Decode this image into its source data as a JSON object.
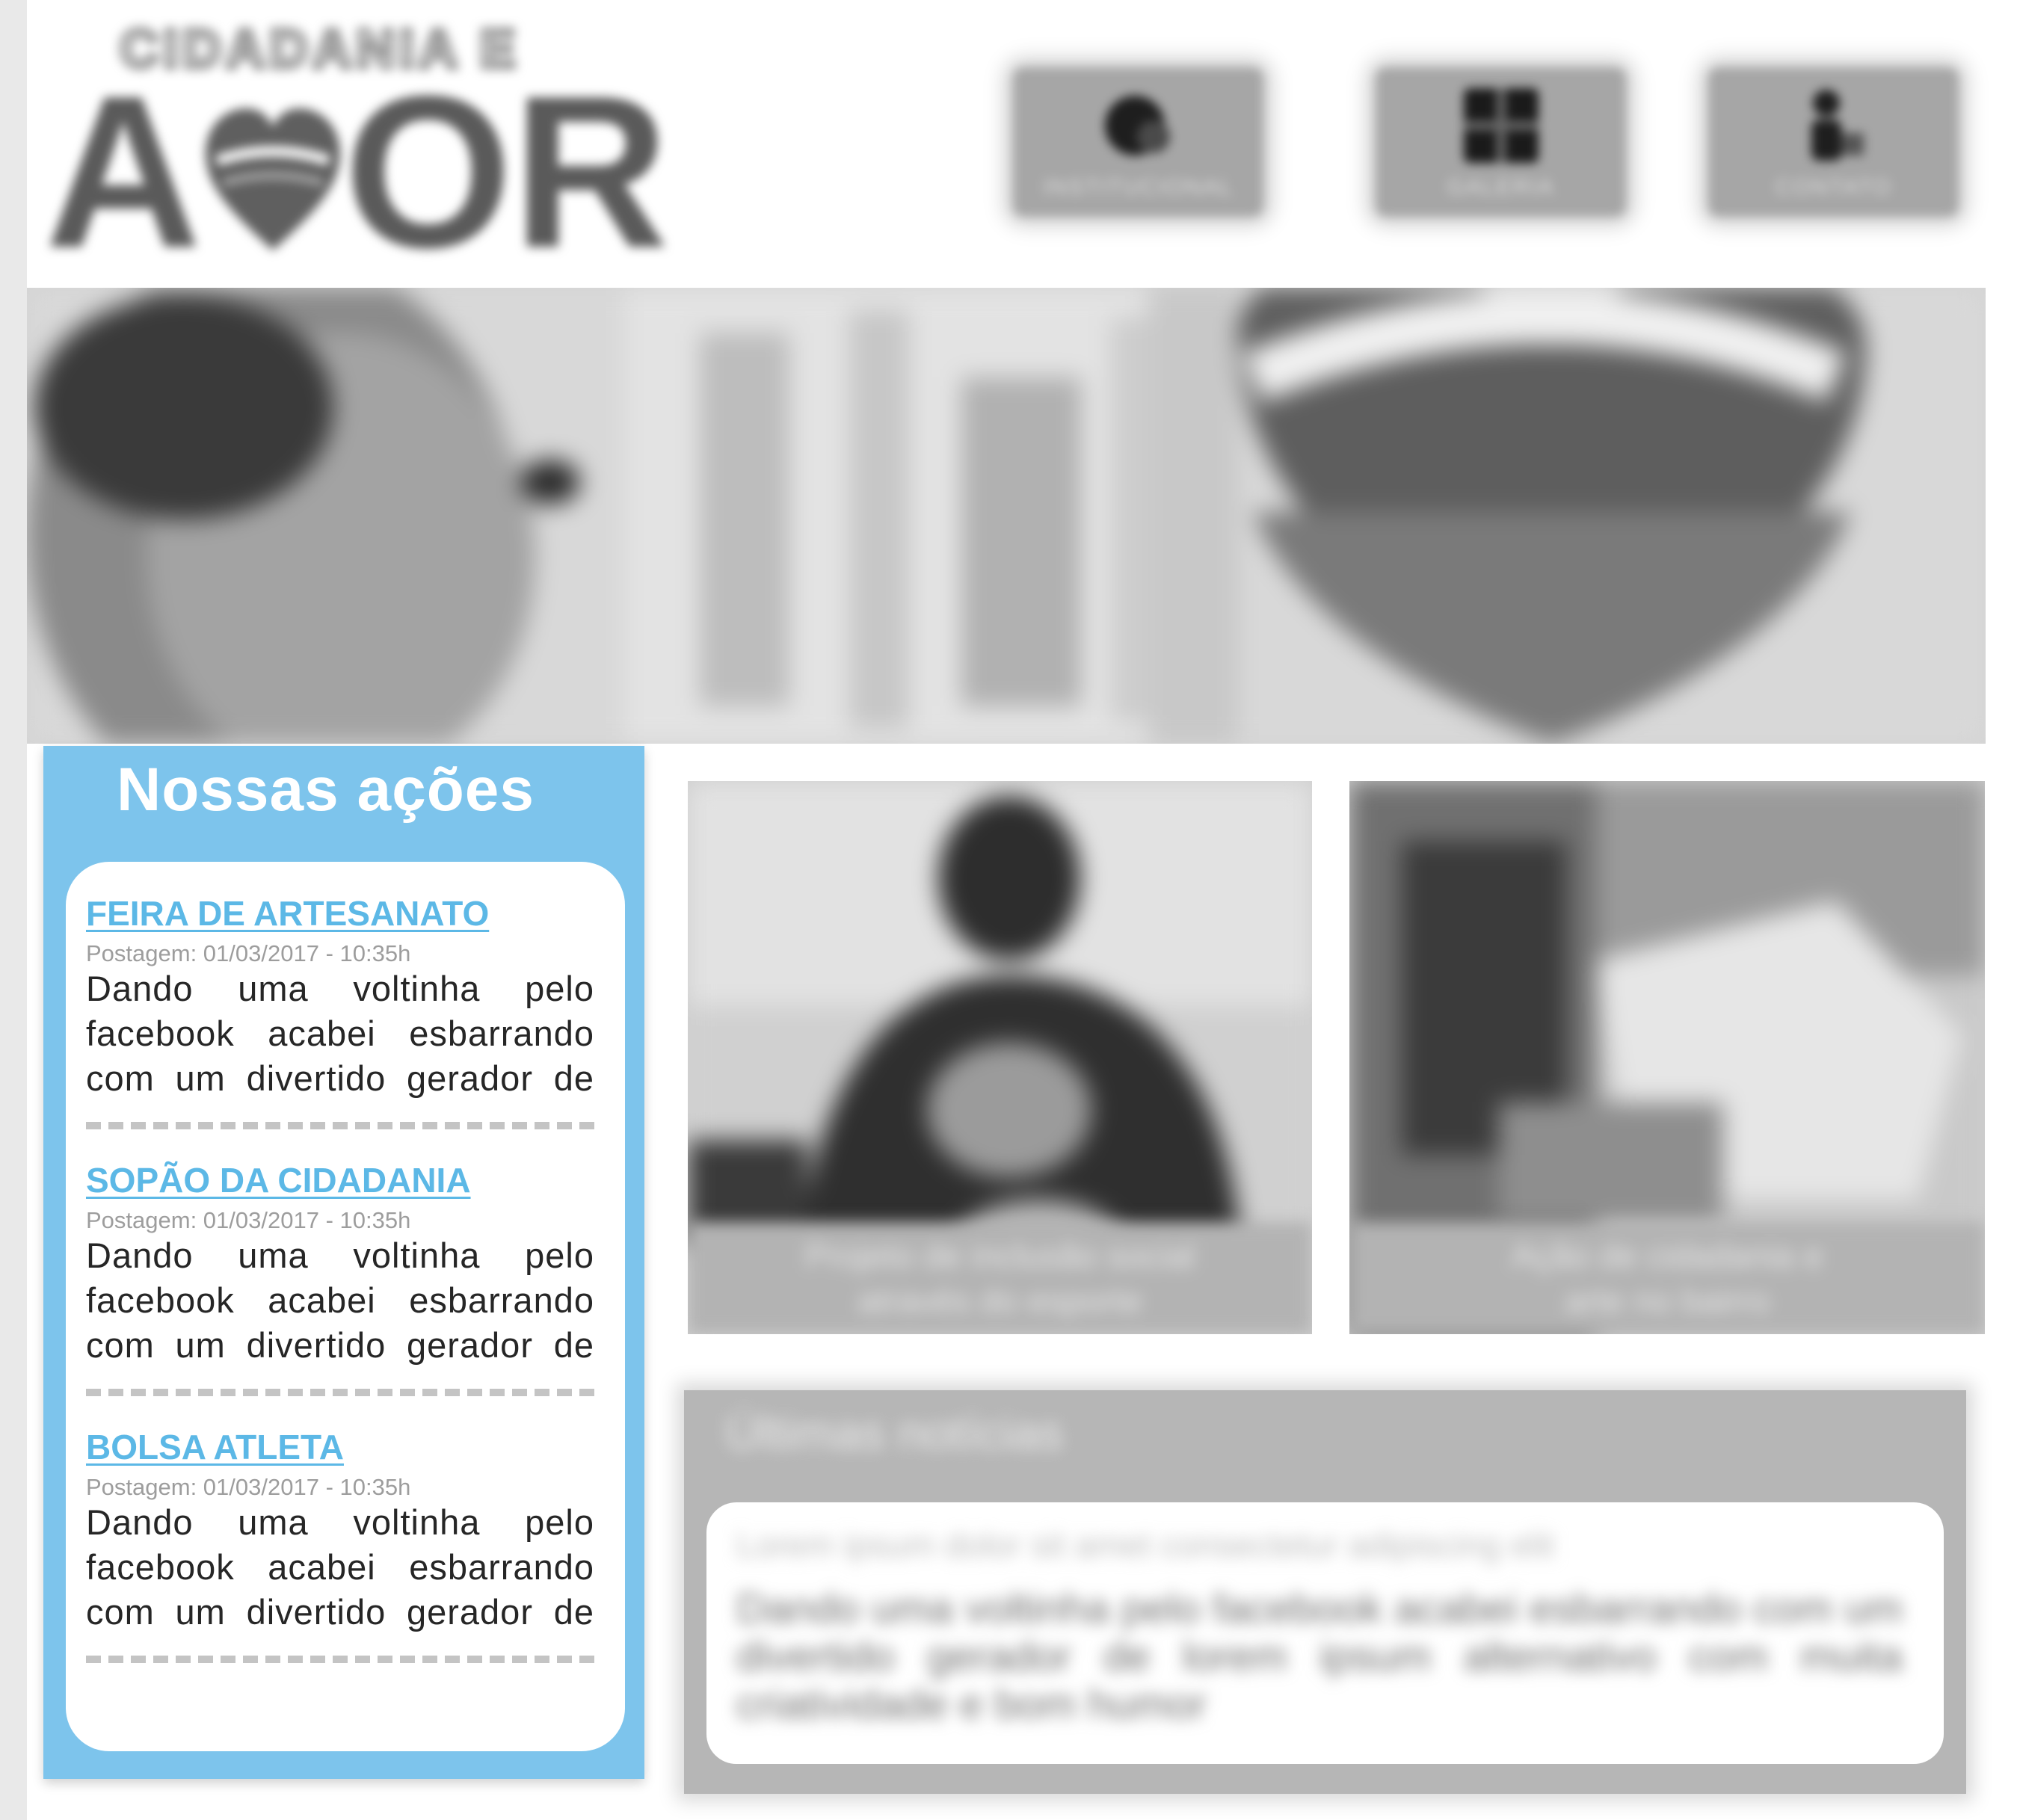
{
  "logo": {
    "tagline": "CIDADANIA E",
    "word_part1": "A",
    "word_part2": "OR"
  },
  "nav": [
    {
      "label": "INSTITUCIONAL",
      "icon": "institution-icon"
    },
    {
      "label": "GALERIA",
      "icon": "gallery-icon"
    },
    {
      "label": "CONTATO",
      "icon": "contact-icon"
    }
  ],
  "actions": {
    "title": "Nossas ações",
    "posts": [
      {
        "title": "FEIRA DE ARTESANATO",
        "date": "Postagem: 01/03/2017 - 10:35h",
        "excerpt": "Dando uma voltinha pelo facebook acabei esbarrando com um divertido gerador de"
      },
      {
        "title": "SOPÃO DA CIDADANIA",
        "date": "Postagem: 01/03/2017 - 10:35h",
        "excerpt": "Dando uma voltinha pelo facebook acabei esbarrando com um divertido gerador de"
      },
      {
        "title": "BOLSA ATLETA",
        "date": "Postagem: 01/03/2017 - 10:35h",
        "excerpt": "Dando uma voltinha pelo facebook acabei esbarrando com um divertido gerador de"
      }
    ]
  },
  "photo_cards": [
    {
      "caption_line1": "Projeto de inclusão social",
      "caption_line2": "através do esporte"
    },
    {
      "caption_line1": "Ação de cidadania e",
      "caption_line2": "arte no bairro"
    }
  ],
  "news": {
    "title": "Últimas notícias",
    "item_title": "Lorem ipsum dolor sit amet consectetur adipiscing elit",
    "item_excerpt": "Dando uma voltinha pelo facebook acabei esbarrando com um divertido gerador de lorem ipsum alternativo com muita criatividade e bom humor"
  },
  "colors": {
    "accent_blue": "#7dc4ec",
    "link_blue": "#5cb8e6",
    "logo_gray": "#5a5a5a"
  }
}
